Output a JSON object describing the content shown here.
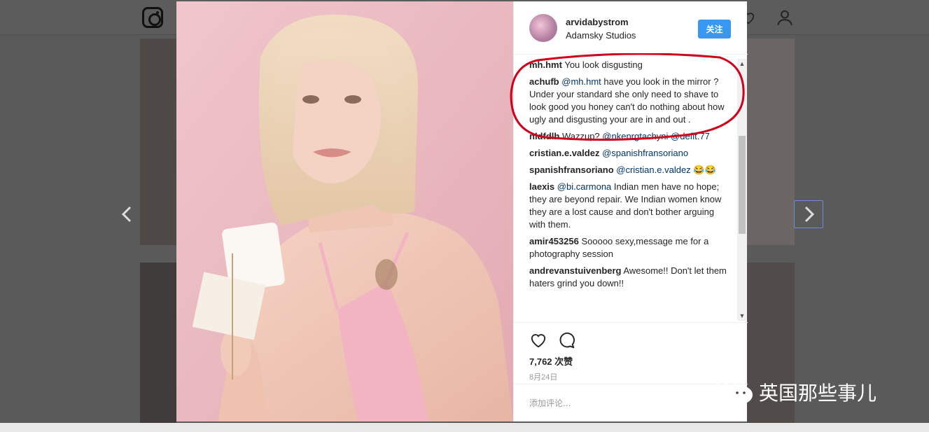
{
  "post": {
    "username": "arvidabystrom",
    "location": "Adamsky Studios",
    "follow_label": "关注",
    "likes": "7,762 次赞",
    "date": "8月24日",
    "add_comment_placeholder": "添加评论..."
  },
  "comments": [
    {
      "author": "mh.hmt",
      "mention": "",
      "text": "You look disgusting"
    },
    {
      "author": "achufb",
      "mention": "@mh.hmt",
      "text": " have you look in the mirror ? Under your standard she only need to shave to look good you honey can't do nothing about how ugly and disgusting your are in and out ."
    },
    {
      "author": "nldfdlh",
      "mention": "",
      "text": "Wazzup? ",
      "mention2": "@nkenrgtachyni @defit.77"
    },
    {
      "author": "cristian.e.valdez",
      "mention": "@spanishfransoriano",
      "text": ""
    },
    {
      "author": "spanishfransoriano",
      "mention": "@cristian.e.valdez",
      "text": " 😂😂"
    },
    {
      "author": "laexis",
      "mention": "@bi.carmona",
      "text": " Indian men have no hope; they are beyond repair. We Indian women know they are a lost cause and don't bother arguing with them."
    },
    {
      "author": "amir453256",
      "mention": "",
      "text": "Sooooo sexy,message me for a photography session"
    },
    {
      "author": "andrevanstuivenberg",
      "mention": "",
      "text": "Awesome!! Don't let them haters grind you down!!"
    }
  ],
  "watermark": "英国那些事儿",
  "icons": {
    "logo": "instagram-logo-icon",
    "prev": "chevron-left-icon",
    "next": "chevron-right-icon",
    "like": "heart-icon",
    "comment": "comment-bubble-icon",
    "wechat": "wechat-icon"
  },
  "colors": {
    "follow_button": "#3897f0",
    "annotation_circle": "#d0021b",
    "mention": "#003569"
  }
}
